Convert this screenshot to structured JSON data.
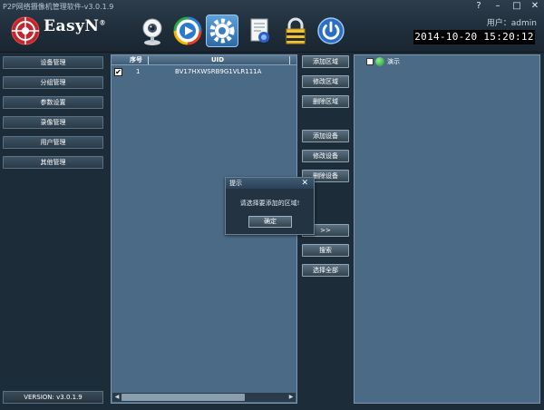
{
  "window": {
    "title": "P2P网络摄像机管理软件-v3.0.1.9",
    "help": "?",
    "minimize": "–",
    "maximize": "□",
    "close": "✕"
  },
  "brand": {
    "logo_text": "EasyN",
    "trademark": "®"
  },
  "toolbar": {
    "icons": [
      "webcam-icon",
      "player-icon",
      "settings-icon",
      "report-icon",
      "lock-icon",
      "power-icon"
    ],
    "active": "settings-icon"
  },
  "header": {
    "user": "用户：admin",
    "datetime": "2014-10-20 15:20:12"
  },
  "sidebar": {
    "items": [
      "设备管理",
      "分组管理",
      "参数设置",
      "录像管理",
      "用户管理",
      "其他管理"
    ],
    "version": "VERSION: v3.0.1.9"
  },
  "device_table": {
    "columns": [
      "序号",
      "UID"
    ],
    "rows": [
      {
        "checked": true,
        "index": "1",
        "uid": "BV17HXWSRB9G1VLR111A"
      }
    ]
  },
  "actions": {
    "add_area": "添加区域",
    "edit_area": "修改区域",
    "delete_area": "删除区域",
    "add_device": "添加设备",
    "edit_device": "修改设备",
    "delete_device": "删除设备",
    "move_right": ">>",
    "search": "搜索",
    "select_all": "选择全部"
  },
  "region_tree": {
    "item_label": "演示",
    "checked": false
  },
  "dialog": {
    "title": "提示",
    "close": "✕",
    "message": "请选择要添加的区域!",
    "ok": "确定"
  },
  "colors": {
    "background": "#1d2c39",
    "panel": "#4a6a86",
    "logo_red": "#c0262c",
    "active_tool": "#3d82c4"
  }
}
